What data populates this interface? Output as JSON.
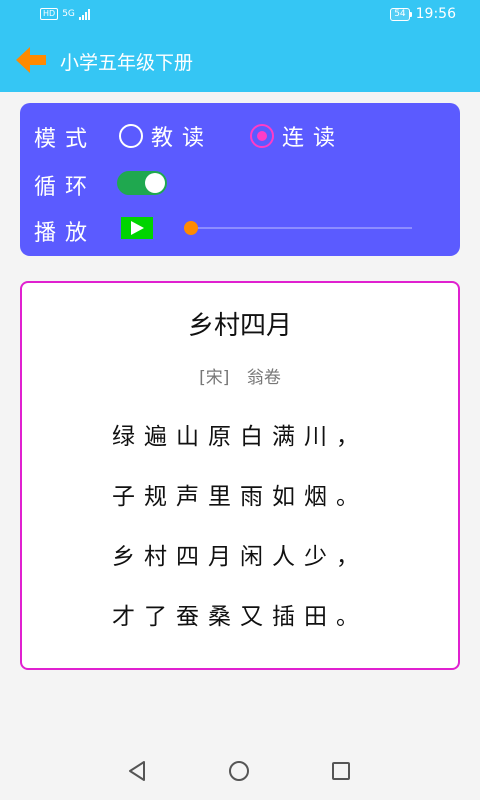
{
  "status_bar": {
    "hd": "HD",
    "network": "5G",
    "battery": "54",
    "time": "19:56"
  },
  "app_bar": {
    "title": "小学五年级下册",
    "back_icon": "arrow-left-icon",
    "color": "#35c6f4"
  },
  "controls": {
    "mode_label": "模式",
    "mode_options": [
      {
        "label": "教读",
        "selected": false
      },
      {
        "label": "连读",
        "selected": true
      }
    ],
    "loop_label": "循环",
    "loop_on": true,
    "play_label": "播放",
    "play_icon": "play-icon",
    "progress": 0,
    "panel_color": "#5b5bff",
    "accent_color": "#ff3cc7"
  },
  "poem": {
    "title": "乡村四月",
    "dynasty": "[宋]",
    "author": "翁卷",
    "lines": [
      "绿遍山原白满川，",
      "子规声里雨如烟。",
      "乡村四月闲人少，",
      "才了蚕桑又插田。"
    ],
    "border_color": "#e020d0"
  },
  "nav_bar": {
    "icons": [
      "back-triangle-icon",
      "home-circle-icon",
      "recent-square-icon"
    ]
  }
}
